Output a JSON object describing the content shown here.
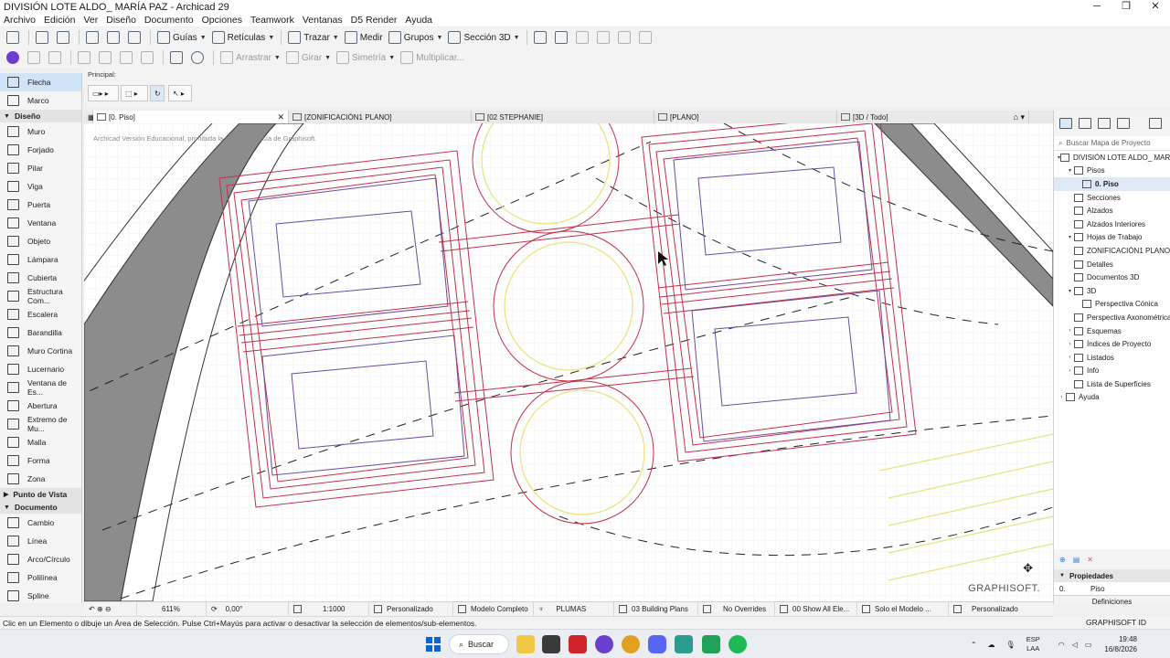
{
  "window": {
    "title": "DIVISIÓN LOTE ALDO_ MARÍA PAZ - Archicad 29",
    "min": "─",
    "max": "❐",
    "close": "✕"
  },
  "menu": [
    "Archivo",
    "Edición",
    "Ver",
    "Diseño",
    "Documento",
    "Opciones",
    "Teamwork",
    "Ventanas",
    "D5 Render",
    "Ayuda"
  ],
  "toolbar": {
    "guias": "Guías",
    "reticulas": "Retículas",
    "trazar": "Trazar",
    "medir": "Medir",
    "grupos": "Grupos",
    "seccion3d": "Sección 3D",
    "arrastrar": "Arrastrar",
    "girar": "Girar",
    "simetria": "Simetría",
    "multiplicar": "Multiplicar..."
  },
  "infobox": {
    "label": "Principal:"
  },
  "toolbox": {
    "top": [
      {
        "label": "Flecha",
        "selected": true
      },
      {
        "label": "Marco"
      }
    ],
    "diseno_title": "Diseño",
    "diseno": [
      "Muro",
      "Forjado",
      "Pilar",
      "Viga",
      "Puerta",
      "Ventana",
      "Objeto",
      "Lámpara",
      "Cubierta",
      "Estructura Com...",
      "Escalera",
      "Barandilla",
      "Muro Cortina",
      "Lucernario",
      "Ventana de Es...",
      "Abertura",
      "Extremo de Mu...",
      "Malla",
      "Forma",
      "Zona"
    ],
    "punto_title": "Punto de Vista",
    "documento_title": "Documento",
    "documento": [
      "Cambio",
      "Línea",
      "Arco/Círculo",
      "Polilínea",
      "Spline"
    ]
  },
  "tabs": [
    {
      "label": "[0. Piso]",
      "active": true
    },
    {
      "label": "[ZONIFICACIÓN1 PLANO]"
    },
    {
      "label": "[02 STEPHANIE]"
    },
    {
      "label": "[PLANO]"
    },
    {
      "label": "[3D / Todo]"
    }
  ],
  "canvas": {
    "watermark": "Archicad Versión Educacional, prohibida la venta. Cortesía de Graphisoft.",
    "logo": "GRAPHISOFT."
  },
  "navigator": {
    "search_placeholder": "Buscar Mapa de Proyecto",
    "items": [
      {
        "label": "DIVISIÓN LOTE ALDO_ MARÍA PAZ",
        "indent": 0,
        "tri": "▾"
      },
      {
        "label": "Pisos",
        "indent": 1,
        "tri": "▾"
      },
      {
        "label": "0. Piso",
        "indent": 2,
        "tri": "",
        "selected": true
      },
      {
        "label": "Secciones",
        "indent": 1,
        "tri": ""
      },
      {
        "label": "Alzados",
        "indent": 1,
        "tri": ""
      },
      {
        "label": "Alzados Interiores",
        "indent": 1,
        "tri": ""
      },
      {
        "label": "Hojas de Trabajo",
        "indent": 1,
        "tri": "▾"
      },
      {
        "label": "ZONIFICACIÓN1 PLANO (",
        "indent": 2,
        "tri": ""
      },
      {
        "label": "Detalles",
        "indent": 1,
        "tri": ""
      },
      {
        "label": "Documentos 3D",
        "indent": 1,
        "tri": ""
      },
      {
        "label": "3D",
        "indent": 1,
        "tri": "▾"
      },
      {
        "label": "Perspectiva Cónica",
        "indent": 2,
        "tri": ""
      },
      {
        "label": "Perspectiva Axonométrica",
        "indent": 2,
        "tri": ""
      },
      {
        "label": "Esquemas",
        "indent": 1,
        "tri": "›"
      },
      {
        "label": "Índices de Proyecto",
        "indent": 1,
        "tri": "›"
      },
      {
        "label": "Listados",
        "indent": 1,
        "tri": "›"
      },
      {
        "label": "Info",
        "indent": 1,
        "tri": "›"
      },
      {
        "label": "Lista de Superficies",
        "indent": 1,
        "tri": ""
      },
      {
        "label": "Ayuda",
        "indent": 0,
        "tri": "›"
      }
    ],
    "properties_title": "Propiedades",
    "prop_id": "0.",
    "prop_value": "Piso",
    "definitions": "Definiciones"
  },
  "viewbar": {
    "zoom": "611%",
    "angle": "0,00°",
    "scale": "1:1000",
    "custom": "Personalizado",
    "model": "Modelo Completo",
    "pens": "PLUMAS",
    "building": "03 Building Plans",
    "overrides": "No Overrides",
    "show": "00 Show All Ele...",
    "solo": "Solo el Modelo ...",
    "custom2": "Personalizado"
  },
  "graphisoft_id": "GRAPHISOFT ID",
  "status": "Clic en un Elemento o dibuje un Área de Selección. Pulse Ctrl+Mayús para activar o desactivar la selección de elementos/sub-elementos.",
  "taskbar": {
    "search": "Buscar",
    "lang1": "ESP",
    "lang2": "LAA",
    "time": "19:48",
    "date": "16/8/2026"
  },
  "colors": {
    "accent": "#0a64d8",
    "red_lines": "#c0304a",
    "violet_lines": "#6a4aa0",
    "yellow_lines": "#e4e46a",
    "selected_tool": "#cfe4f7"
  }
}
